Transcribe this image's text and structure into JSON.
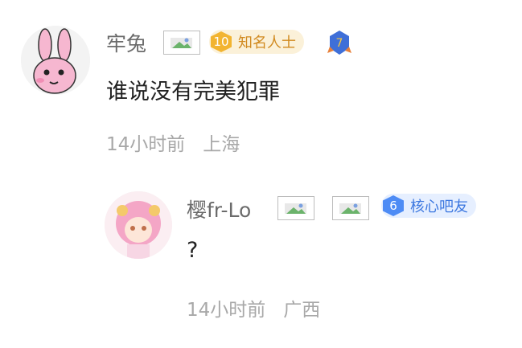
{
  "comment": {
    "username": "牢兔",
    "text": "谁说没有完美犯罪",
    "time": "14小时前",
    "location": "上海",
    "level_badge": {
      "level": "10",
      "title": "知名人士",
      "color": "#f2b431"
    },
    "rank_icon": {
      "level": "7",
      "color": "#3f6fd8"
    }
  },
  "reply": {
    "username": "樱fr-Lo",
    "text": "?",
    "time": "14小时前",
    "location": "广西",
    "level_badge": {
      "level": "6",
      "title": "核心吧友",
      "color": "#4e8cf5"
    }
  }
}
